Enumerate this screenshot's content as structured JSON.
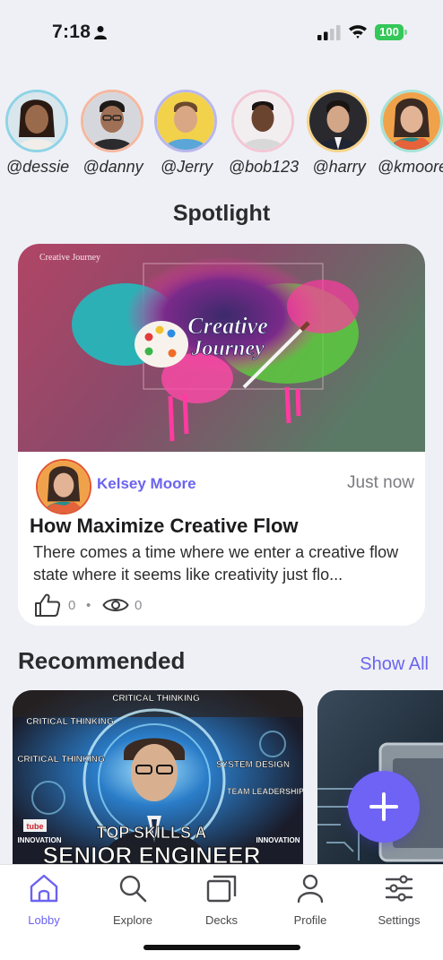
{
  "status_bar": {
    "time": "7:18",
    "battery": "100",
    "icons": [
      "person-icon",
      "signal-icon",
      "wifi-icon",
      "battery-icon"
    ]
  },
  "stories": [
    {
      "handle": "@dessie",
      "ring_color": "#8fd3e6"
    },
    {
      "handle": "@danny",
      "ring_color": "#f5b8a0"
    },
    {
      "handle": "@Jerry",
      "ring_color": "#b9b6ee"
    },
    {
      "handle": "@bob123",
      "ring_color": "#f3c7d4"
    },
    {
      "handle": "@harry",
      "ring_color": "#f6d48a"
    },
    {
      "handle": "@kmoore",
      "ring_color": "#a7e2d8"
    }
  ],
  "spotlight": {
    "section_title": "Spotlight",
    "image_text": {
      "corner": "Creative Journey",
      "title_line1": "Creative",
      "title_line2": "Journey"
    },
    "author": "Kelsey Moore",
    "time": "Just now",
    "title": "How Maximize Creative Flow",
    "body": "There comes a time where we enter a creative flow state where it seems like creativity just flo...",
    "likes": "0",
    "separator": "•",
    "views": "0"
  },
  "recommended": {
    "section_title": "Recommended",
    "show_all": "Show All",
    "cards": [
      {
        "tags": [
          "CRITICAL THINKING",
          "CRITICAL THINKING",
          "CRITICAL THINKING",
          "SYSTEM DESIGN",
          "TEAM LEADERSHIP",
          "INNOVATION",
          "INNOVATION"
        ],
        "badge": "tube",
        "headline1": "TOP SKILLS A",
        "headline2": "SENIOR ENGINEER"
      }
    ]
  },
  "fab": {
    "icon": "plus-icon"
  },
  "tabbar": {
    "tabs": [
      {
        "label": "Lobby",
        "icon": "home-icon",
        "active": true
      },
      {
        "label": "Explore",
        "icon": "search-icon",
        "active": false
      },
      {
        "label": "Decks",
        "icon": "decks-icon",
        "active": false
      },
      {
        "label": "Profile",
        "icon": "profile-icon",
        "active": false
      },
      {
        "label": "Settings",
        "icon": "sliders-icon",
        "active": false
      }
    ]
  },
  "colors": {
    "accent": "#6b63f0",
    "background": "#eef0f5",
    "battery": "#34c759"
  }
}
